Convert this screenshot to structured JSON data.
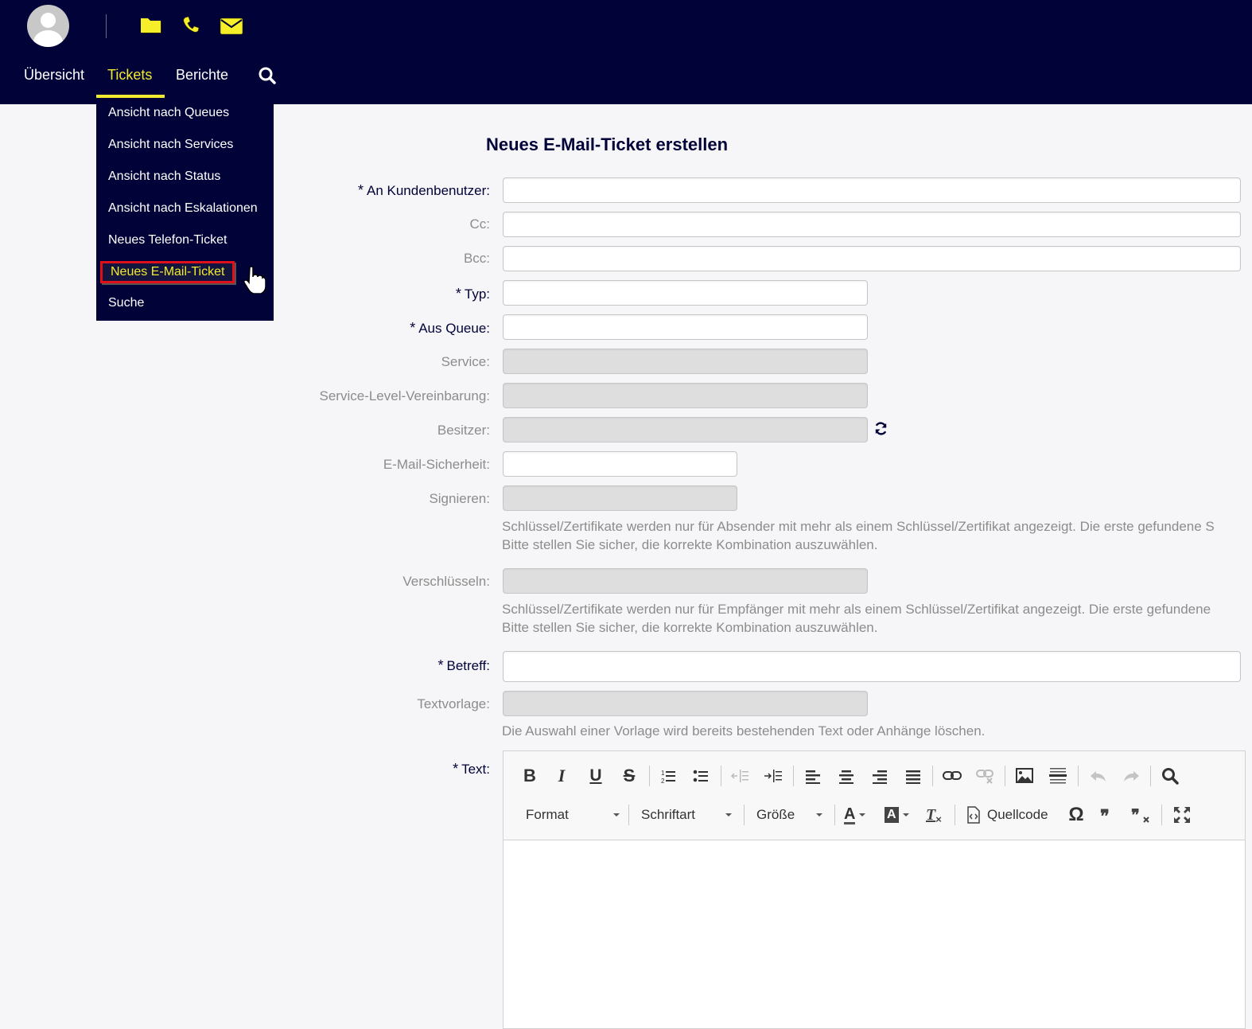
{
  "header": {
    "quick_icons": [
      "folder-icon",
      "phone-icon",
      "envelope-icon"
    ],
    "nav": [
      {
        "label": "Übersicht",
        "active": false
      },
      {
        "label": "Tickets",
        "active": true
      },
      {
        "label": "Berichte",
        "active": false
      }
    ],
    "accent_color": "#f2ea2e",
    "bar_color": "#000238"
  },
  "tickets_menu": {
    "items": [
      {
        "label": "Ansicht nach Queues"
      },
      {
        "label": "Ansicht nach Services"
      },
      {
        "label": "Ansicht nach Status"
      },
      {
        "label": "Ansicht nach Eskalationen"
      },
      {
        "label": "Neues Telefon-Ticket"
      },
      {
        "label": "Neues E-Mail-Ticket",
        "highlighted": true
      },
      {
        "label": "Suche"
      }
    ]
  },
  "form": {
    "title": "Neues E-Mail-Ticket erstellen",
    "required_marker": "*",
    "fields": {
      "customer_user": {
        "label": "An Kundenbenutzer:",
        "required": true,
        "value": ""
      },
      "cc": {
        "label": "Cc:",
        "value": ""
      },
      "bcc": {
        "label": "Bcc:",
        "value": ""
      },
      "type": {
        "label": "Typ:",
        "required": true,
        "value": ""
      },
      "queue": {
        "label": "Aus Queue:",
        "required": true,
        "value": ""
      },
      "service": {
        "label": "Service:",
        "value": "",
        "disabled": true
      },
      "sla": {
        "label": "Service-Level-Vereinbarung:",
        "value": "",
        "disabled": true
      },
      "owner": {
        "label": "Besitzer:",
        "value": "",
        "disabled": true
      },
      "email_security": {
        "label": "E-Mail-Sicherheit:",
        "value": ""
      },
      "sign": {
        "label": "Signieren:",
        "value": "",
        "disabled": true
      },
      "encrypt": {
        "label": "Verschlüsseln:",
        "value": "",
        "disabled": true
      },
      "subject": {
        "label": "Betreff:",
        "required": true,
        "value": ""
      },
      "template": {
        "label": "Textvorlage:",
        "value": "",
        "disabled": true
      },
      "text": {
        "label": "Text:",
        "required": true,
        "value": ""
      }
    },
    "hints": {
      "sign_line1": "Schlüssel/Zertifikate werden nur für Absender mit mehr als einem Schlüssel/Zertifikat angezeigt. Die erste gefundene S",
      "sign_line2": "Bitte stellen Sie sicher, die korrekte Kombination auszuwählen.",
      "encrypt_line1": "Schlüssel/Zertifikate werden nur für Empfänger mit mehr als einem Schlüssel/Zertifikat angezeigt. Die erste gefundene",
      "encrypt_line2": "Bitte stellen Sie sicher, die korrekte Kombination auszuwählen.",
      "template": "Die Auswahl einer Vorlage wird bereits bestehenden Text oder Anhänge löschen."
    }
  },
  "editor": {
    "toolbar_row1": [
      "bold-icon",
      "italic-icon",
      "underline-icon",
      "strikethrough-icon",
      "numbered-list-icon",
      "bulleted-list-icon",
      "outdent-icon",
      "indent-icon",
      "align-left-icon",
      "align-center-icon",
      "align-right-icon",
      "justify-icon",
      "link-icon",
      "unlink-icon",
      "image-icon",
      "horizontal-line-icon",
      "undo-icon",
      "redo-icon",
      "find-icon"
    ],
    "format_label": "Format",
    "font_label": "Schriftart",
    "size_label": "Größe",
    "source_label": "Quellcode",
    "glyphs": {
      "bold": "B",
      "italic": "I",
      "underline": "U",
      "strike": "S",
      "text_color": "A",
      "bg_color": "A",
      "remove_format": "T",
      "special_char": "Ω"
    }
  }
}
